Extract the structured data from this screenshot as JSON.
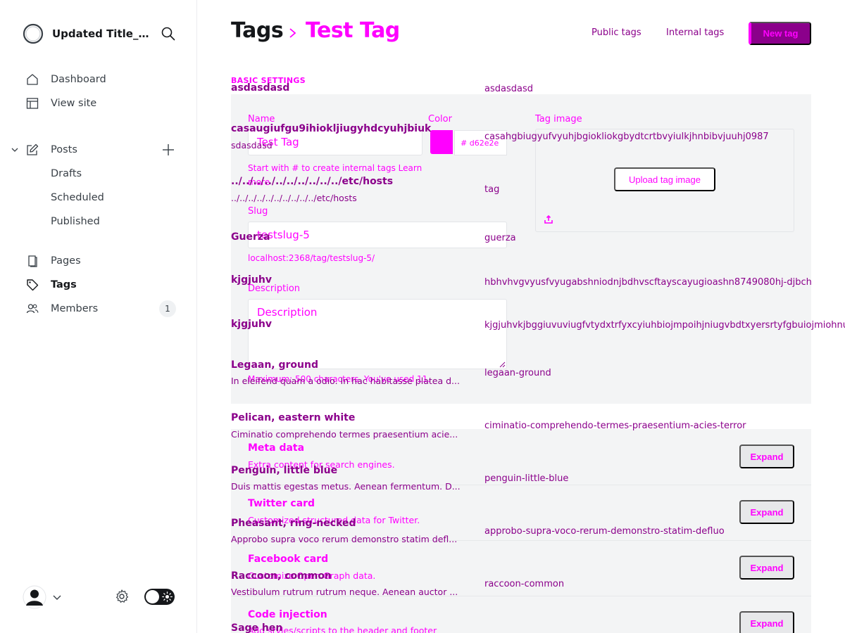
{
  "sidebar": {
    "site_title": "Updated Title_17...",
    "nav": {
      "dashboard": "Dashboard",
      "view_site": "View site",
      "posts": "Posts",
      "drafts": "Drafts",
      "scheduled": "Scheduled",
      "published": "Published",
      "pages": "Pages",
      "tags": "Tags",
      "members": "Members",
      "members_count": "1"
    }
  },
  "header": {
    "breadcrumb_parent": "Tags",
    "breadcrumb_current": "Test Tag",
    "public_tags": "Public tags",
    "internal_tags": "Internal tags",
    "new_tag": "New tag"
  },
  "form": {
    "section_title": "BASIC SETTINGS",
    "name_label": "Name",
    "name_value": "Test Tag",
    "name_hint": "Start with # to create internal tags Learn more",
    "color_label": "Color",
    "color_value": "d62e2e",
    "color_hex": "#ff00ff",
    "tag_image_label": "Tag image",
    "upload_label": "Upload tag image",
    "slug_label": "Slug",
    "slug_value": "testslug-5",
    "slug_url": "localhost:2368/tag/testslug-5/",
    "description_label": "Description",
    "description_placeholder": "Description",
    "description_hint": "Maximum: 500 characters. You've used 11."
  },
  "advanced": [
    {
      "title": "Meta data",
      "desc": "Extra content for search engines.",
      "button": "Expand"
    },
    {
      "title": "Twitter card",
      "desc": "Customized structured data for Twitter.",
      "button": "Expand"
    },
    {
      "title": "Facebook card",
      "desc": "Customize Open Graph data.",
      "button": "Expand"
    },
    {
      "title": "Code injection",
      "desc": "Add styles/scripts to the header and footer",
      "button": "Expand"
    }
  ],
  "tag_list": [
    {
      "name": "asdasdasd",
      "desc": "",
      "slug": "asdasdasd"
    },
    {
      "name": "casaugiufgu9ihiokljiugyhdcyuhjbiuk",
      "desc": "sdasdasd",
      "slug": "casahgbiugyufvyuhjbgiokliokgbydtcrtbvyiulkjhnbibvjuuhj0987"
    },
    {
      "name": "../../../../../../../../../../etc/hosts",
      "desc": "../../../../../../../../../../etc/hosts",
      "slug": "tag"
    },
    {
      "name": "Guerza",
      "desc": "",
      "slug": "guerza"
    },
    {
      "name": "kjgjuhv",
      "desc": "",
      "slug": "hbhvhvgvyusfvyugabshniodnjbdhvscftayscayugioashn8749080hj-djbch"
    },
    {
      "name": "kjgjuhv",
      "desc": "",
      "slug": "kjgjuhvkjbggiuvuviugfvtydxtrfyxcyiuhbiojmpoihjniugvbdtxyersrtyfgbuiojmiohnuif"
    },
    {
      "name": "Legaan, ground",
      "desc": "In eleifend quam a odio. In hac habitasse platea d...",
      "slug": "legaan-ground"
    },
    {
      "name": "Pelican, eastern white",
      "desc": "Ciminatio comprehendo termes praesentium acie...",
      "slug": "ciminatio-comprehendo-termes-praesentium-acies-terror"
    },
    {
      "name": "Penguin, little blue",
      "desc": "Duis mattis egestas metus. Aenean fermentum. D...",
      "slug": "penguin-little-blue"
    },
    {
      "name": "Pheasant, ring-necked",
      "desc": "Approbo supra voco rerum demonstro statim defl...",
      "slug": "approbo-supra-voco-rerum-demonstro-statim-defluo"
    },
    {
      "name": "Raccoon, common",
      "desc": "Vestibulum rutrum rutrum neque. Aenean auctor ...",
      "slug": "raccoon-common"
    },
    {
      "name": "Sage hen",
      "desc": "",
      "slug": ""
    }
  ],
  "colors": {
    "accent": "#ff00ff",
    "accent_dark": "#8b008b"
  }
}
